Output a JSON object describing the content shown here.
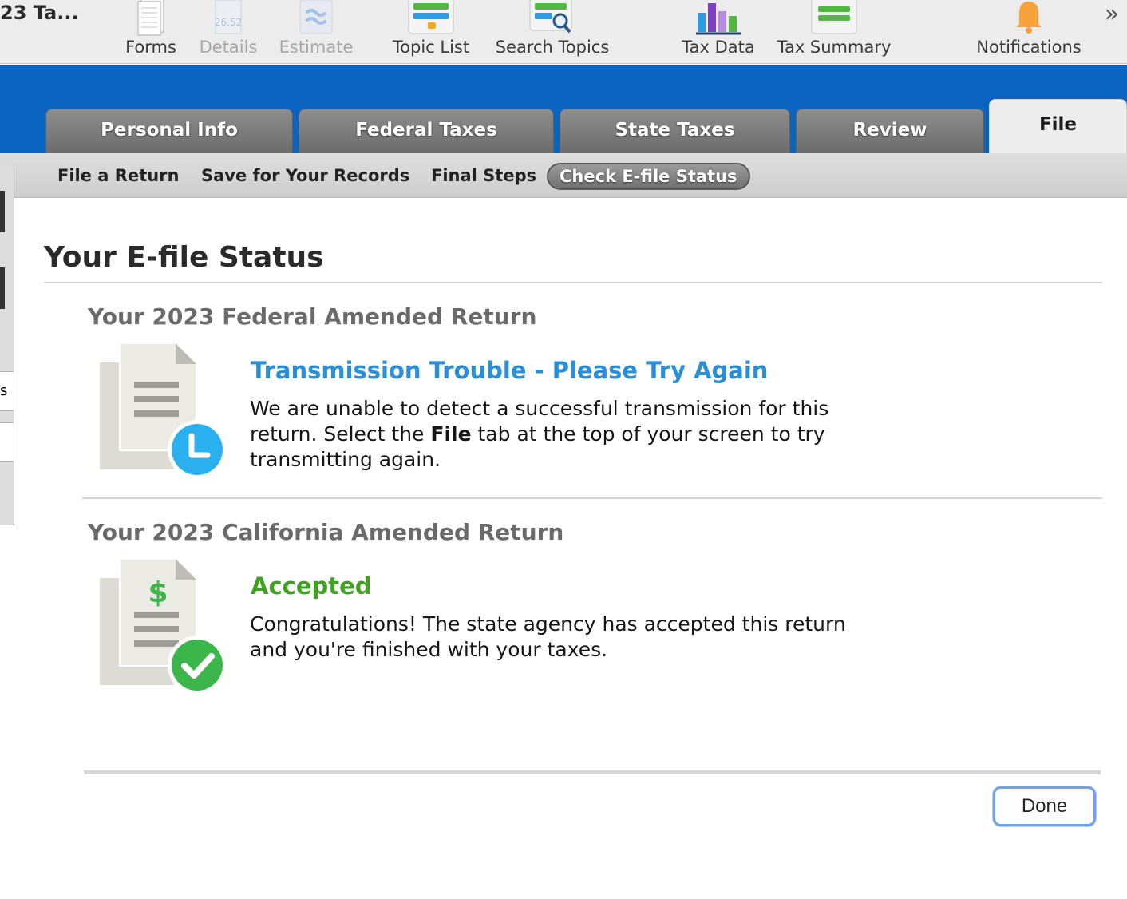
{
  "app": {
    "title": "23 Ta..."
  },
  "toolbar": {
    "items": [
      {
        "label": "Forms"
      },
      {
        "label": "Details",
        "icon_text": "26.52"
      },
      {
        "label": "Estimate"
      },
      {
        "label": "Topic List"
      },
      {
        "label": "Search Topics"
      },
      {
        "label": "Tax Data"
      },
      {
        "label": "Tax Summary"
      },
      {
        "label": "Notifications"
      }
    ],
    "more": "»"
  },
  "main_tabs": [
    {
      "label": "Personal Info"
    },
    {
      "label": "Federal Taxes"
    },
    {
      "label": "State Taxes"
    },
    {
      "label": "Review"
    },
    {
      "label": "File"
    }
  ],
  "sub_tabs": [
    {
      "label": "File a Return"
    },
    {
      "label": "Save for Your Records"
    },
    {
      "label": "Final Steps"
    },
    {
      "label": "Check E-file Status"
    }
  ],
  "sidebar_fragment": {
    "text": "s"
  },
  "page": {
    "title": "Your E-file Status",
    "returns": [
      {
        "title": "Your 2023 Federal Amended Return",
        "status": "Transmission Trouble - Please Try Again",
        "status_color": "#2a8fd8",
        "message_before": "We are unable to detect a successful transmission for this return. Select the ",
        "message_bold": "File",
        "message_after": " tab at the top of your screen to try transmitting again.",
        "badge": "clock-icon",
        "badge_color": "#2bb0ef"
      },
      {
        "title": "Your 2023 California Amended Return",
        "status": "Accepted",
        "status_color": "#3ea21f",
        "message": "Congratulations! The state agency has accepted this return and you're finished with your taxes.",
        "badge": "checkmark-icon",
        "badge_color": "#3cb54a",
        "doc_symbol": "$"
      }
    ],
    "done_label": "Done"
  }
}
